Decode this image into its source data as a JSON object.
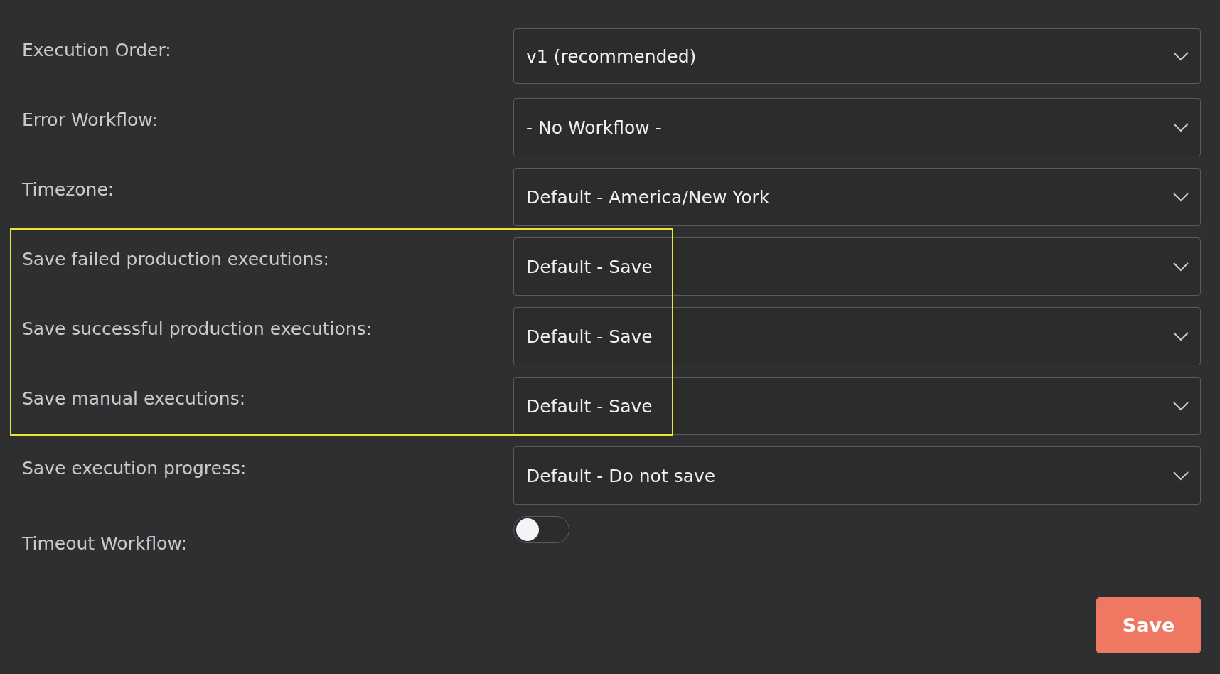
{
  "settings": [
    {
      "kind": "select",
      "label": "Execution Order:",
      "value": "v1 (recommended)",
      "highlighted": false
    },
    {
      "kind": "select",
      "label": "Error Workflow:",
      "value": "- No Workflow -",
      "highlighted": false
    },
    {
      "kind": "select",
      "label": "Timezone:",
      "value": "Default - America/New York",
      "highlighted": false
    },
    {
      "kind": "select",
      "label": "Save failed production executions:",
      "value": "Default - Save",
      "highlighted": true
    },
    {
      "kind": "select",
      "label": "Save successful production executions:",
      "value": "Default - Save",
      "highlighted": true
    },
    {
      "kind": "select",
      "label": "Save manual executions:",
      "value": "Default - Save",
      "highlighted": true
    },
    {
      "kind": "select",
      "label": "Save execution progress:",
      "value": "Default - Do not save",
      "highlighted": false
    },
    {
      "kind": "toggle",
      "label": "Timeout Workflow:",
      "on": false,
      "highlighted": false
    }
  ],
  "save_button": "Save"
}
